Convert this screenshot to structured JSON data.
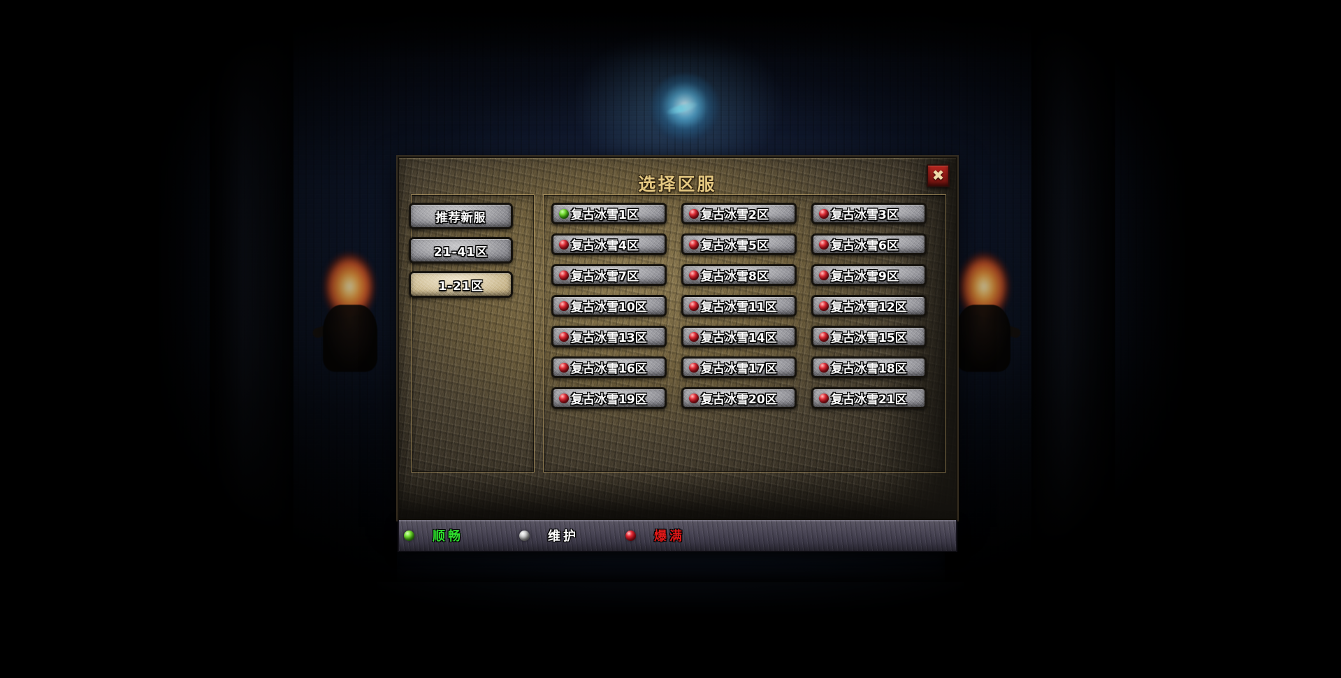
{
  "accent_colors": {
    "title_gold": "#e4c882",
    "close_red": "#8f1a15",
    "status_smooth": "#2ee02e",
    "status_maintenance": "#ffffff",
    "status_full": "#e01818",
    "panel_stone": "#6f5f3c",
    "button_stone": "#a9a9ad",
    "button_active_stone": "#ddcfae"
  },
  "dialog": {
    "title": "选择区服",
    "close_icon": "close-x-icon"
  },
  "sidebar": {
    "items": [
      {
        "label": "推荐新服",
        "active": false
      },
      {
        "label": "21-41区",
        "active": false
      },
      {
        "label": "1-21区",
        "active": true
      }
    ]
  },
  "servers": {
    "columns": 3,
    "rows": 7,
    "items": [
      {
        "label": "复古冰雪1区",
        "status": "green"
      },
      {
        "label": "复古冰雪2区",
        "status": "red"
      },
      {
        "label": "复古冰雪3区",
        "status": "red"
      },
      {
        "label": "复古冰雪4区",
        "status": "red"
      },
      {
        "label": "复古冰雪5区",
        "status": "red"
      },
      {
        "label": "复古冰雪6区",
        "status": "red"
      },
      {
        "label": "复古冰雪7区",
        "status": "red"
      },
      {
        "label": "复古冰雪8区",
        "status": "red"
      },
      {
        "label": "复古冰雪9区",
        "status": "red"
      },
      {
        "label": "复古冰雪10区",
        "status": "red"
      },
      {
        "label": "复古冰雪11区",
        "status": "red"
      },
      {
        "label": "复古冰雪12区",
        "status": "red"
      },
      {
        "label": "复古冰雪13区",
        "status": "red"
      },
      {
        "label": "复古冰雪14区",
        "status": "red"
      },
      {
        "label": "复古冰雪15区",
        "status": "red"
      },
      {
        "label": "复古冰雪16区",
        "status": "red"
      },
      {
        "label": "复古冰雪17区",
        "status": "red"
      },
      {
        "label": "复古冰雪18区",
        "status": "red"
      },
      {
        "label": "复古冰雪19区",
        "status": "red"
      },
      {
        "label": "复古冰雪20区",
        "status": "red"
      },
      {
        "label": "复古冰雪21区",
        "status": "red"
      }
    ]
  },
  "legend": {
    "items": [
      {
        "label": "顺畅",
        "status": "green",
        "color": "#2ee02e"
      },
      {
        "label": "维护",
        "status": "grey",
        "color": "#ffffff"
      },
      {
        "label": "爆满",
        "status": "red",
        "color": "#e01818"
      }
    ]
  }
}
